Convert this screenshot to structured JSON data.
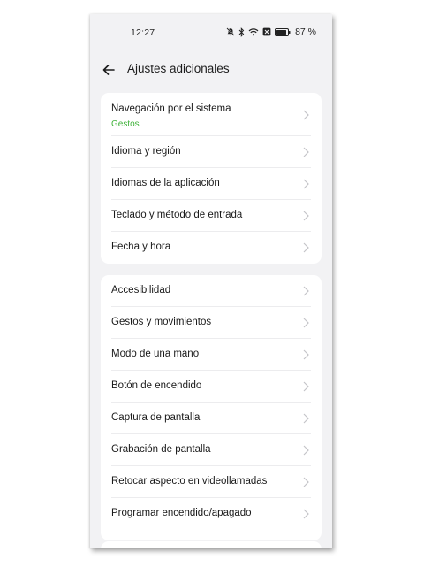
{
  "status_bar": {
    "time": "12:27",
    "battery": "87 %",
    "icons": [
      "bell-off-icon",
      "bluetooth-icon",
      "wifi-icon",
      "sim-icon",
      "battery-icon"
    ]
  },
  "header": {
    "back_icon": "arrow-left-icon",
    "title": "Ajustes adicionales"
  },
  "sections": [
    {
      "items": [
        {
          "label": "Navegación por el sistema",
          "subtitle": "Gestos"
        },
        {
          "label": "Idioma y región"
        },
        {
          "label": "Idiomas de la aplicación"
        },
        {
          "label": "Teclado y método de entrada"
        },
        {
          "label": "Fecha y hora"
        }
      ]
    },
    {
      "items": [
        {
          "label": "Accesibilidad"
        },
        {
          "label": "Gestos y movimientos"
        },
        {
          "label": "Modo de una mano"
        },
        {
          "label": "Botón de encendido"
        },
        {
          "label": "Captura de pantalla"
        },
        {
          "label": "Grabación de pantalla"
        },
        {
          "label": "Retocar aspecto en videollamadas"
        },
        {
          "label": "Programar encendido/apagado"
        }
      ]
    }
  ],
  "colors": {
    "accent_subtitle": "#3fb23a",
    "background": "#f2f2f4",
    "card": "#ffffff"
  }
}
